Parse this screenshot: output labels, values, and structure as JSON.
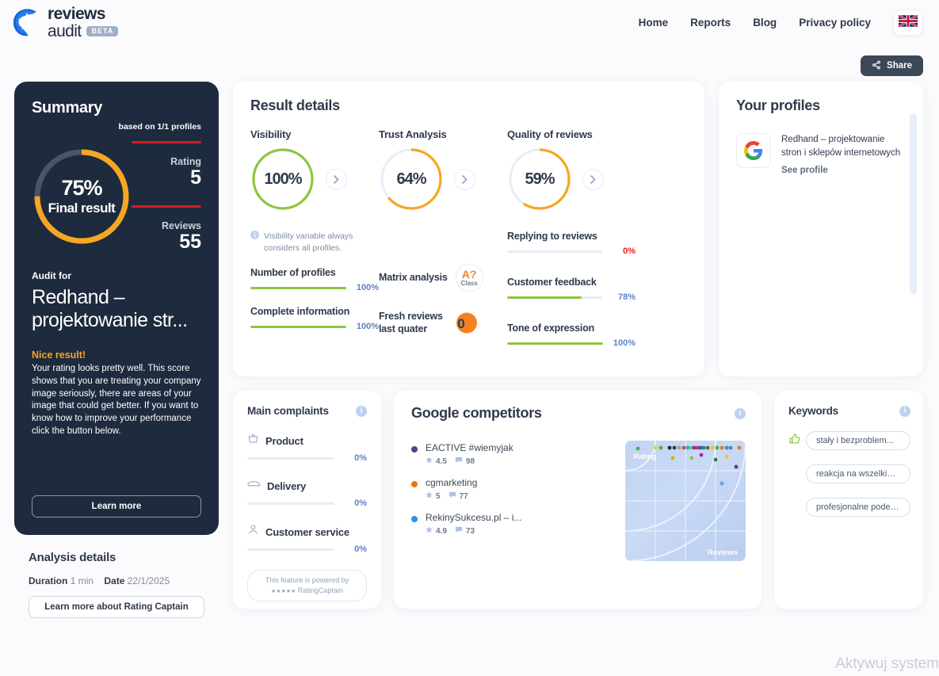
{
  "header": {
    "logo_line1": "reviews",
    "logo_line2": "audit",
    "beta": "BETA",
    "nav": [
      {
        "label": "Home"
      },
      {
        "label": "Reports"
      },
      {
        "label": "Blog"
      },
      {
        "label": "Privacy policy"
      }
    ],
    "flag_icon": "uk-flag-icon"
  },
  "share": {
    "label": "Share",
    "icon": "share-icon"
  },
  "summary": {
    "title": "Summary",
    "based_on": "based on 1/1 profiles",
    "score_pct": "75%",
    "score_pct_value": 75,
    "score_label": "Final result",
    "stats": [
      {
        "key": "Rating",
        "value": "5"
      },
      {
        "key": "Reviews",
        "value": "55"
      }
    ],
    "audit_for_label": "Audit for",
    "audit_name": "Redhand – projektowanie str...",
    "verdict_title": "Nice result!",
    "verdict_body": "Your rating looks pretty well. This score shows that you are treating your company image seriously, there are areas of your image that could get better. If you want to know how to improve your performance click the button below.",
    "cta": "Learn more",
    "accent": "#f5a623",
    "rule_color": "#cf2026"
  },
  "analysis": {
    "title": "Analysis details",
    "duration_label": "Duration",
    "duration_value": "1 min",
    "date_label": "Date",
    "date_value": "22/1/2025",
    "cta": "Learn more about Rating Captain"
  },
  "result_details": {
    "title": "Result details",
    "metrics": [
      {
        "title": "Visibility",
        "value": "100%",
        "pct": 100,
        "color": "#8dc63f"
      },
      {
        "title": "Trust Analysis",
        "value": "64%",
        "pct": 64,
        "color": "#f5a623"
      },
      {
        "title": "Quality of reviews",
        "value": "59%",
        "pct": 59,
        "color": "#f5a623"
      }
    ],
    "note": "Visibility variable always considers all profiles.",
    "note_icon": "info-icon",
    "left_bars": [
      {
        "label": "Number of profiles",
        "value": "100%",
        "pct": 100,
        "color": "#8dc63f"
      },
      {
        "label": "Complete information",
        "value": "100%",
        "pct": 100,
        "color": "#8dc63f"
      }
    ],
    "middle": [
      {
        "label": "Matrix analysis",
        "badge_top": "A?",
        "badge_bottom": "Class",
        "type": "class"
      },
      {
        "label": "Fresh reviews last quater",
        "badge_top": "0",
        "type": "dot"
      }
    ],
    "right_bars": [
      {
        "label": "Replying to reviews",
        "value": "0%",
        "pct": 0,
        "color": "#8dc63f",
        "value_color": "#e02020"
      },
      {
        "label": "Customer feedback",
        "value": "78%",
        "pct": 78,
        "color": "#8dc63f",
        "value_color": "#5d84c4"
      },
      {
        "label": "Tone of expression",
        "value": "100%",
        "pct": 100,
        "color": "#8dc63f",
        "value_color": "#5d84c4"
      }
    ]
  },
  "profiles": {
    "title": "Your profiles",
    "items": [
      {
        "icon": "google-icon",
        "name": "Redhand – projektowanie stron i sklepów internetowych",
        "link": "See profile"
      }
    ]
  },
  "complaints": {
    "title": "Main complaints",
    "info_icon": "info-icon",
    "items": [
      {
        "icon": "basket-icon",
        "label": "Product",
        "value": "0%",
        "pct": 0
      },
      {
        "icon": "truck-icon",
        "label": "Delivery",
        "value": "0%",
        "pct": 0
      },
      {
        "icon": "person-icon",
        "label": "Customer service",
        "value": "0%",
        "pct": 0
      }
    ],
    "powered_line1": "This feature is powered by",
    "powered_stars": "★★★★★",
    "powered_brand": "RatingCaptain"
  },
  "competitors": {
    "title": "Google competitors",
    "info_icon": "info-icon",
    "items": [
      {
        "name": "EACTIVE #wiemyjak",
        "rating": "4.5",
        "reviews": "98",
        "color": "#5c3b8e"
      },
      {
        "name": "cgmarketing",
        "rating": "5",
        "reviews": "77",
        "color": "#e07b16"
      },
      {
        "name": "RekinySukcesu.pl – i...",
        "rating": "4.9",
        "reviews": "73",
        "color": "#2f8ff0"
      }
    ],
    "matrix_y_label": "Rating",
    "matrix_x_label": "Reviews"
  },
  "keywords": {
    "title": "Keywords",
    "info_icon": "info-icon",
    "thumb_icon": "thumbs-up-icon",
    "items": [
      {
        "label": "stały i bezproblem...",
        "has_thumb": true
      },
      {
        "label": "reakcja na wszelkie pr...",
        "has_thumb": false
      },
      {
        "label": "profesjonalne podejśc...",
        "has_thumb": false
      }
    ]
  },
  "watermark": "Aktywuj system"
}
